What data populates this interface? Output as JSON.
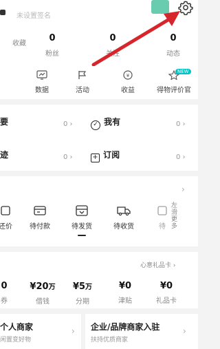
{
  "header": {
    "profile_hint": "未设置签名",
    "settings_icon": "gear-icon",
    "badge_color": "#4fc3a0"
  },
  "stats": [
    {
      "value": "",
      "label": "收藏"
    },
    {
      "value": "0",
      "label": "粉丝"
    },
    {
      "value": "0",
      "label": "关注"
    },
    {
      "value": "0",
      "label": "动态"
    }
  ],
  "tools": [
    {
      "icon": "chart-icon",
      "label": "数据"
    },
    {
      "icon": "flag-icon",
      "label": "活动"
    },
    {
      "icon": "coin-icon",
      "label": "收益"
    },
    {
      "icon": "star-icon",
      "label": "得物评价官",
      "badge": "NEW"
    }
  ],
  "quick_rows": [
    [
      {
        "title": "要",
        "count": "0"
      },
      {
        "title": "我有",
        "count": "0",
        "icon": "check-circle-icon"
      }
    ],
    [
      {
        "title": "迹",
        "count": "0"
      },
      {
        "title": "订阅",
        "count": "0",
        "icon": "plus-square-icon"
      }
    ]
  ],
  "orders": {
    "items": [
      {
        "icon": "tag-icon",
        "label": "还价"
      },
      {
        "icon": "wallet-icon",
        "label": "待付款"
      },
      {
        "icon": "box-icon",
        "label": "待发货"
      },
      {
        "icon": "truck-icon",
        "label": "待收货"
      },
      {
        "icon": "review-icon",
        "label": "待"
      }
    ],
    "more_hint": "左滑更多"
  },
  "wallet": {
    "top_link": "心意礼品卡",
    "items": [
      {
        "value": "0",
        "label": "券"
      },
      {
        "value": "¥20",
        "unit": "万",
        "label": "借钱"
      },
      {
        "value": "¥5",
        "unit": "万",
        "label": "分期"
      },
      {
        "value": "¥0",
        "label": "津贴"
      },
      {
        "value": "¥0",
        "label": "礼品卡"
      }
    ]
  },
  "merchant": [
    {
      "title": "个人商家",
      "subtitle": "闲置变好物"
    },
    {
      "title": "企业/品牌商家入驻",
      "subtitle": "扶持优质商家"
    }
  ],
  "colors": {
    "arrow": "#d6262b",
    "accent": "#01c2c3"
  }
}
